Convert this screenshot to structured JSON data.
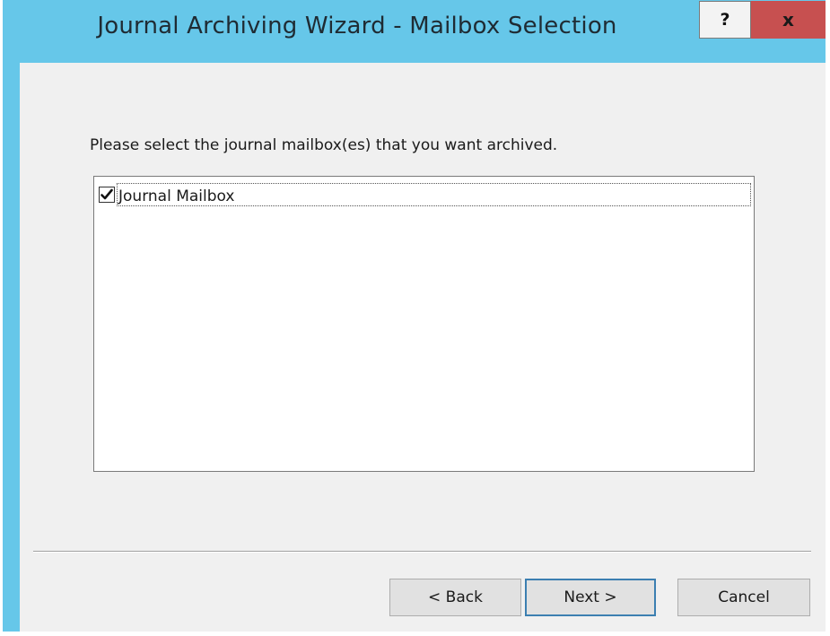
{
  "window": {
    "title": "Journal Archiving Wizard - Mailbox Selection",
    "help_label": "?",
    "close_label": "x"
  },
  "main": {
    "prompt": "Please select the journal mailbox(es) that you want archived.",
    "mailboxes": [
      {
        "label": "Journal Mailbox",
        "checked": true
      }
    ]
  },
  "buttons": {
    "back": "< Back",
    "next": "Next >",
    "cancel": "Cancel"
  },
  "colors": {
    "titlebar": "#66c7e9",
    "close": "#c75050",
    "client": "#f0f0f0"
  }
}
